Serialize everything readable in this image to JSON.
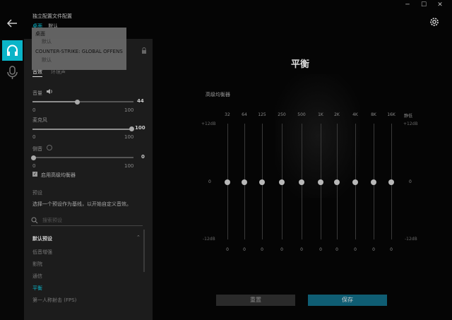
{
  "header": {
    "section_title": "独立配置文件配置",
    "profile_prefix": "桌面",
    "profile_current": "默认"
  },
  "popup": {
    "items": [
      {
        "title": "桌面",
        "sub": "默认"
      },
      {
        "title": "COUNTER-STRIKE: GLOBAL OFFENS",
        "sub": "默认"
      }
    ]
  },
  "tabs": {
    "active": "音效",
    "inactive": "环境声"
  },
  "sliders": [
    {
      "label": "音量",
      "value": "44",
      "min": "0",
      "max": "100",
      "level": 0.44
    },
    {
      "label": "麦克风",
      "value": "100",
      "min": "0",
      "max": "100",
      "level": 1.0
    },
    {
      "label": "侧音",
      "value": "0",
      "min": "0",
      "max": "100",
      "level": 0.0
    }
  ],
  "eq_checkbox_label": "启用高级均衡器",
  "presets": {
    "heading": "预设",
    "description": "选择一个预设作为基线，以开始自定义音效。",
    "search_placeholder": "搜索预设",
    "group_title": "默认预设",
    "items": [
      "低音增强",
      "影院",
      "通信",
      "平衡",
      "第一人称射击 (FPS)"
    ],
    "active_index": 3
  },
  "main": {
    "title": "平衡",
    "eq_title": "高级均衡器",
    "bands": [
      "32",
      "64",
      "125",
      "250",
      "500",
      "1K",
      "2K",
      "4K",
      "8K",
      "16K"
    ],
    "band_values": [
      "0",
      "0",
      "0",
      "0",
      "0",
      "0",
      "0",
      "0",
      "0",
      "0"
    ],
    "mute_label": "静低",
    "scale_top": "+12dB",
    "scale_mid": "0",
    "scale_bottom": "-12dB",
    "reset_label": "重置",
    "save_label": "保存"
  },
  "colors": {
    "accent": "#0ab4c8",
    "panel": "#1c1c1c",
    "save": "#0f5d73"
  }
}
